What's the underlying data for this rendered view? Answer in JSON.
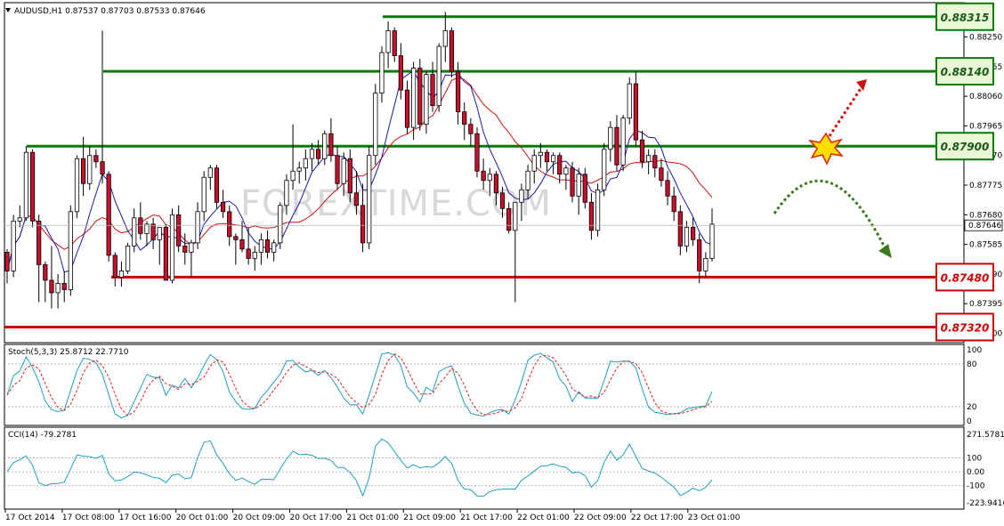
{
  "chart_data": {
    "type": "candlestick",
    "symbol_header": "AUDUSD,H1  0.87537 0.87703 0.87533 0.87646",
    "watermark": "FOREXTIME.COM",
    "price_range": [
      0.8727,
      0.8836
    ],
    "price_ticks": [
      "0.88250",
      "0.88155",
      "0.88060",
      "0.87965",
      "0.87870",
      "0.87775",
      "0.87680",
      "0.87585",
      "0.87490",
      "0.87395",
      "0.87300"
    ],
    "current_price": "0.87646",
    "levels": [
      {
        "label": "0.88315",
        "value": 0.88315,
        "color": "#0a7a0a",
        "kind": "resistance"
      },
      {
        "label": "0.88140",
        "value": 0.8814,
        "color": "#0a7a0a",
        "kind": "resistance"
      },
      {
        "label": "0.87900",
        "value": 0.879,
        "color": "#0a7a0a",
        "kind": "resistance"
      },
      {
        "label": "0.87480",
        "value": 0.8748,
        "color": "#cc0000",
        "kind": "support"
      },
      {
        "label": "0.87320",
        "value": 0.8732,
        "color": "#cc0000",
        "kind": "support"
      }
    ],
    "candles": [
      [
        0.8756,
        0.8757,
        0.8746,
        0.875
      ],
      [
        0.875,
        0.8768,
        0.8748,
        0.8766
      ],
      [
        0.8766,
        0.8771,
        0.8764,
        0.8767
      ],
      [
        0.8767,
        0.879,
        0.8766,
        0.8788
      ],
      [
        0.8788,
        0.8789,
        0.8764,
        0.8766
      ],
      [
        0.8766,
        0.8768,
        0.874,
        0.8752
      ],
      [
        0.8752,
        0.8753,
        0.874,
        0.8747
      ],
      [
        0.8747,
        0.8758,
        0.8738,
        0.8743
      ],
      [
        0.8743,
        0.8749,
        0.8738,
        0.8746
      ],
      [
        0.8746,
        0.875,
        0.874,
        0.8744
      ],
      [
        0.8744,
        0.8771,
        0.8742,
        0.8769
      ],
      [
        0.8769,
        0.8787,
        0.8767,
        0.8786
      ],
      [
        0.8786,
        0.8793,
        0.8774,
        0.8778
      ],
      [
        0.8778,
        0.879,
        0.8776,
        0.8787
      ],
      [
        0.8787,
        0.8789,
        0.8783,
        0.8785
      ],
      [
        0.8785,
        0.8827,
        0.8778,
        0.8781
      ],
      [
        0.8781,
        0.8782,
        0.8753,
        0.8755
      ],
      [
        0.8755,
        0.8756,
        0.8745,
        0.8748
      ],
      [
        0.8748,
        0.8753,
        0.8745,
        0.875
      ],
      [
        0.875,
        0.8759,
        0.8749,
        0.8758
      ],
      [
        0.8758,
        0.877,
        0.8756,
        0.8767
      ],
      [
        0.8767,
        0.8772,
        0.876,
        0.8762
      ],
      [
        0.8762,
        0.8766,
        0.8758,
        0.8765
      ],
      [
        0.8765,
        0.8767,
        0.8757,
        0.876
      ],
      [
        0.876,
        0.8764,
        0.8752,
        0.8764
      ],
      [
        0.8764,
        0.8765,
        0.8747,
        0.8747
      ],
      [
        0.8747,
        0.877,
        0.8746,
        0.8768
      ],
      [
        0.8768,
        0.8771,
        0.8756,
        0.8758
      ],
      [
        0.8758,
        0.8762,
        0.8752,
        0.8756
      ],
      [
        0.8756,
        0.876,
        0.8748,
        0.8759
      ],
      [
        0.8759,
        0.8772,
        0.8757,
        0.8769
      ],
      [
        0.8769,
        0.8782,
        0.8766,
        0.878
      ],
      [
        0.878,
        0.8784,
        0.8776,
        0.8783
      ],
      [
        0.8783,
        0.8784,
        0.877,
        0.8772
      ],
      [
        0.8772,
        0.8776,
        0.8767,
        0.8769
      ],
      [
        0.8769,
        0.8771,
        0.8758,
        0.8761
      ],
      [
        0.8761,
        0.8762,
        0.8752,
        0.876
      ],
      [
        0.876,
        0.8766,
        0.8756,
        0.8757
      ],
      [
        0.8757,
        0.8764,
        0.8752,
        0.8754
      ],
      [
        0.8754,
        0.8758,
        0.875,
        0.8756
      ],
      [
        0.8756,
        0.8762,
        0.8752,
        0.876
      ],
      [
        0.876,
        0.8763,
        0.8754,
        0.8756
      ],
      [
        0.8756,
        0.876,
        0.8753,
        0.8759
      ],
      [
        0.8759,
        0.8772,
        0.8757,
        0.8771
      ],
      [
        0.8771,
        0.8781,
        0.8768,
        0.8779
      ],
      [
        0.8779,
        0.8797,
        0.8776,
        0.8782
      ],
      [
        0.8782,
        0.8785,
        0.8778,
        0.8783
      ],
      [
        0.8783,
        0.8789,
        0.8779,
        0.8786
      ],
      [
        0.8786,
        0.8791,
        0.8782,
        0.8789
      ],
      [
        0.8789,
        0.8792,
        0.8784,
        0.8786
      ],
      [
        0.8786,
        0.8795,
        0.8784,
        0.8794
      ],
      [
        0.8794,
        0.8799,
        0.8785,
        0.8787
      ],
      [
        0.8787,
        0.879,
        0.8776,
        0.8778
      ],
      [
        0.8778,
        0.8788,
        0.8774,
        0.8786
      ],
      [
        0.8786,
        0.8789,
        0.8772,
        0.8775
      ],
      [
        0.8775,
        0.8782,
        0.8768,
        0.8771
      ],
      [
        0.8771,
        0.8778,
        0.8756,
        0.8759
      ],
      [
        0.8759,
        0.879,
        0.8757,
        0.8787
      ],
      [
        0.8787,
        0.881,
        0.8784,
        0.8807
      ],
      [
        0.8807,
        0.8822,
        0.8804,
        0.882
      ],
      [
        0.882,
        0.883,
        0.8815,
        0.8827
      ],
      [
        0.8827,
        0.8828,
        0.8817,
        0.8819
      ],
      [
        0.8819,
        0.8823,
        0.8805,
        0.8808
      ],
      [
        0.8808,
        0.8811,
        0.8794,
        0.8796
      ],
      [
        0.8796,
        0.8817,
        0.8792,
        0.8815
      ],
      [
        0.8815,
        0.8818,
        0.8795,
        0.8797
      ],
      [
        0.8797,
        0.8814,
        0.8794,
        0.8813
      ],
      [
        0.8813,
        0.8817,
        0.8801,
        0.8803
      ],
      [
        0.8803,
        0.8823,
        0.8801,
        0.8822
      ],
      [
        0.8822,
        0.8833,
        0.8817,
        0.8827
      ],
      [
        0.8827,
        0.8828,
        0.8812,
        0.8814
      ],
      [
        0.8814,
        0.8817,
        0.8797,
        0.8801
      ],
      [
        0.8801,
        0.8804,
        0.8792,
        0.8797
      ],
      [
        0.8797,
        0.8799,
        0.879,
        0.8794
      ],
      [
        0.8794,
        0.8796,
        0.878,
        0.8782
      ],
      [
        0.8782,
        0.8786,
        0.8776,
        0.8779
      ],
      [
        0.8779,
        0.8783,
        0.8774,
        0.8781
      ],
      [
        0.8781,
        0.8782,
        0.8771,
        0.8775
      ],
      [
        0.8775,
        0.8777,
        0.8767,
        0.877
      ],
      [
        0.877,
        0.8772,
        0.8762,
        0.8763
      ],
      [
        0.8763,
        0.8764,
        0.874,
        0.8772
      ],
      [
        0.8772,
        0.8778,
        0.8766,
        0.8776
      ],
      [
        0.8776,
        0.8784,
        0.8773,
        0.8782
      ],
      [
        0.8782,
        0.8789,
        0.8778,
        0.8787
      ],
      [
        0.8787,
        0.8791,
        0.8783,
        0.8788
      ],
      [
        0.8788,
        0.8789,
        0.8782,
        0.8785
      ],
      [
        0.8785,
        0.8788,
        0.8781,
        0.8787
      ],
      [
        0.8787,
        0.8788,
        0.8778,
        0.8781
      ],
      [
        0.8781,
        0.8784,
        0.8776,
        0.8783
      ],
      [
        0.8783,
        0.8785,
        0.8772,
        0.8774
      ],
      [
        0.8774,
        0.8783,
        0.8768,
        0.8781
      ],
      [
        0.8781,
        0.8783,
        0.877,
        0.8772
      ],
      [
        0.8772,
        0.8775,
        0.876,
        0.8763
      ],
      [
        0.8763,
        0.8778,
        0.8761,
        0.8776
      ],
      [
        0.8776,
        0.8791,
        0.8774,
        0.8789
      ],
      [
        0.8789,
        0.8798,
        0.8785,
        0.8796
      ],
      [
        0.8796,
        0.88,
        0.8782,
        0.8784
      ],
      [
        0.8784,
        0.88,
        0.8782,
        0.8799
      ],
      [
        0.8799,
        0.8812,
        0.8797,
        0.881
      ],
      [
        0.881,
        0.8814,
        0.879,
        0.8792
      ],
      [
        0.8792,
        0.8795,
        0.8783,
        0.8785
      ],
      [
        0.8785,
        0.8789,
        0.8781,
        0.8787
      ],
      [
        0.8787,
        0.8789,
        0.878,
        0.8783
      ],
      [
        0.8783,
        0.8786,
        0.8777,
        0.8779
      ],
      [
        0.8779,
        0.8782,
        0.8771,
        0.8774
      ],
      [
        0.8774,
        0.8777,
        0.8766,
        0.8769
      ],
      [
        0.8769,
        0.8771,
        0.8755,
        0.8758
      ],
      [
        0.8758,
        0.8766,
        0.8756,
        0.8764
      ],
      [
        0.8764,
        0.8767,
        0.8758,
        0.876
      ],
      [
        0.876,
        0.8762,
        0.8746,
        0.875
      ],
      [
        0.875,
        0.8756,
        0.8748,
        0.8754
      ],
      [
        0.8754,
        0.877,
        0.8753,
        0.8765
      ]
    ],
    "x_tick_labels": [
      "17 Oct 2014",
      "17 Oct 08:00",
      "17 Oct 16:00",
      "20 Oct 01:00",
      "20 Oct 09:00",
      "20 Oct 17:00",
      "21 Oct 01:00",
      "21 Oct 09:00",
      "21 Oct 17:00",
      "22 Oct 01:00",
      "22 Oct 09:00",
      "22 Oct 17:00",
      "23 Oct 01:00"
    ],
    "ma_fast_color": "#1a1aa6",
    "ma_slow_color": "#cc1111",
    "bull_color": "#ffffff",
    "bear_color": "#c8102e",
    "stoch": {
      "header": "Stoch(5,3,3) 25.8712 22.7710",
      "ticks": [
        "100",
        "80",
        "20",
        "0"
      ],
      "k_color": "#1f9fc4",
      "d_color": "#dd2222"
    },
    "cci": {
      "header": "CCI(14) -79.2781",
      "ticks": [
        "271.5781",
        "100",
        "0.00",
        "-100",
        "-223.9416"
      ],
      "color": "#1f9fc4"
    },
    "forecast_up_color": "#cc1111",
    "forecast_down_color": "#3a7a1a"
  }
}
